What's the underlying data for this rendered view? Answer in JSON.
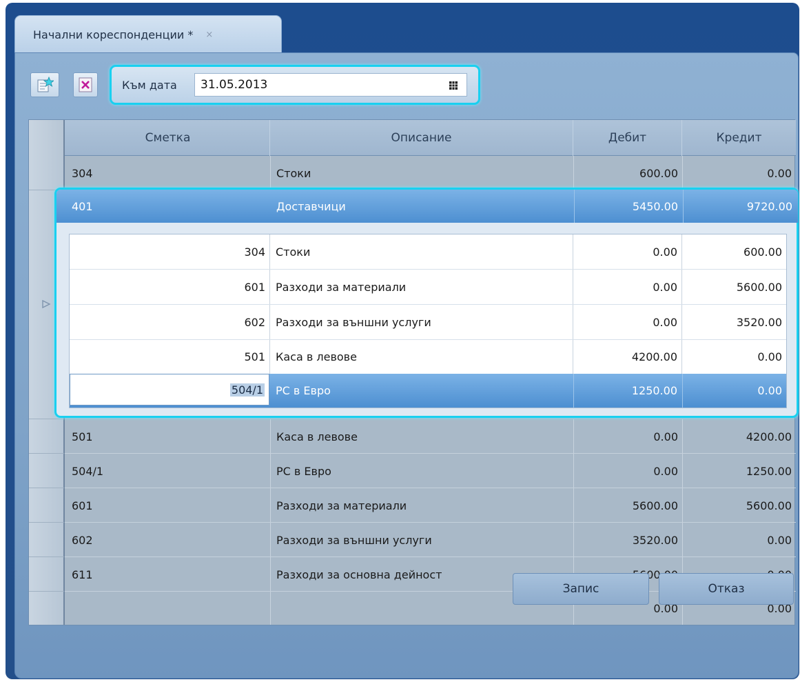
{
  "tab": {
    "title": "Начални кореспонденции *",
    "close_icon": "×"
  },
  "toolbar": {
    "new_icon": "new-record-icon",
    "delete_icon": "delete-icon",
    "date_label": "Към дата",
    "date_value": "31.05.2013",
    "calendar_icon": "calendar-icon"
  },
  "grid": {
    "columns": [
      "Сметка",
      "Описание",
      "Дебит",
      "Кредит"
    ],
    "rows": [
      {
        "account": "304",
        "description": "Стоки",
        "debit": "600.00",
        "credit": "0.00"
      },
      {
        "account": "401",
        "description": "Доставчици",
        "debit": "5450.00",
        "credit": "9720.00",
        "details": [
          {
            "account": "304",
            "description": "Стоки",
            "debit": "0.00",
            "credit": "600.00"
          },
          {
            "account": "601",
            "description": "Разходи за материали",
            "debit": "0.00",
            "credit": "5600.00"
          },
          {
            "account": "602",
            "description": "Разходи за външни услуги",
            "debit": "0.00",
            "credit": "3520.00"
          },
          {
            "account": "501",
            "description": "Каса в левове",
            "debit": "4200.00",
            "credit": "0.00"
          },
          {
            "account": "504/1",
            "description": "РС в Евро",
            "debit": "1250.00",
            "credit": "0.00"
          }
        ]
      },
      {
        "account": "501",
        "description": "Каса в левове",
        "debit": "0.00",
        "credit": "4200.00"
      },
      {
        "account": "504/1",
        "description": "РС в Евро",
        "debit": "0.00",
        "credit": "1250.00"
      },
      {
        "account": "601",
        "description": "Разходи за материали",
        "debit": "5600.00",
        "credit": "5600.00"
      },
      {
        "account": "602",
        "description": "Разходи за външни услуги",
        "debit": "3520.00",
        "credit": "0.00"
      },
      {
        "account": "611",
        "description": "Разходи за основна дейност",
        "debit": "5600.00",
        "credit": "0.00"
      },
      {
        "account": "",
        "description": "",
        "debit": "0.00",
        "credit": "0.00"
      }
    ]
  },
  "footer": {
    "save_label": "Запис",
    "cancel_label": "Отказ"
  },
  "colors": {
    "accent": "#19d0f0",
    "selection": "#4d8fd1",
    "panel": "#8fb1d3"
  }
}
